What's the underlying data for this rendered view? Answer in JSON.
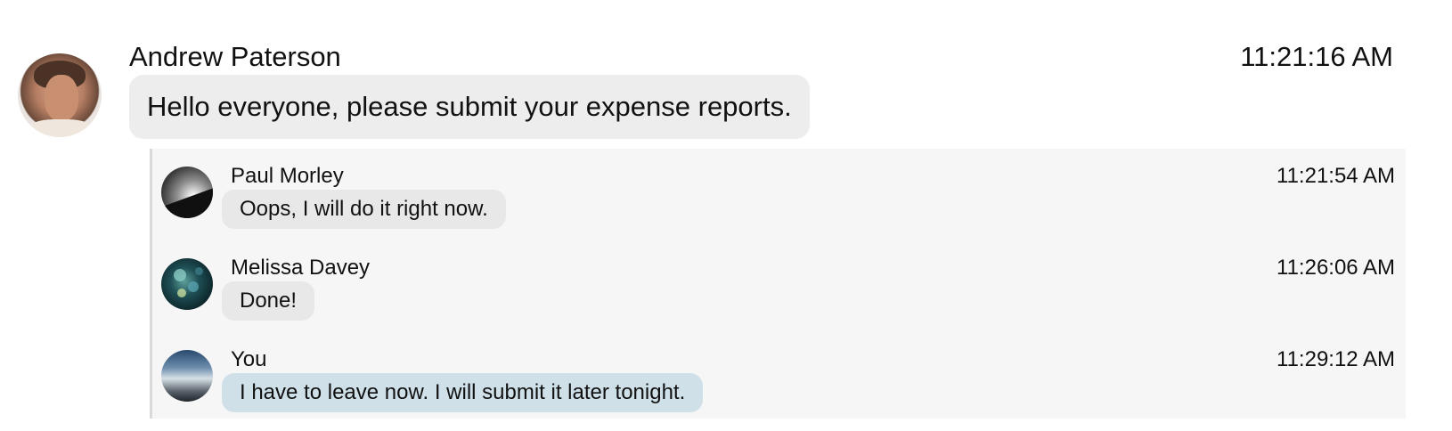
{
  "root_message": {
    "author": "Andrew Paterson",
    "time": "11:21:16 AM",
    "text": "Hello everyone, please submit your expense reports.",
    "avatar_icon": "user-photo-andrew"
  },
  "replies": [
    {
      "author": "Paul Morley",
      "time": "11:21:54 AM",
      "text": "Oops, I will do it right now.",
      "avatar_icon": "user-photo-paul",
      "is_self": false
    },
    {
      "author": "Melissa Davey",
      "time": "11:26:06 AM",
      "text": "Done!",
      "avatar_icon": "user-photo-melissa",
      "is_self": false
    },
    {
      "author": "You",
      "time": "11:29:12 AM",
      "text": "I have to leave now. I will submit it later tonight.",
      "avatar_icon": "user-photo-you",
      "is_self": true
    }
  ],
  "colors": {
    "bubble_default": "#ededed",
    "bubble_reply": "#e8e8e8",
    "bubble_self": "#cfe0e9",
    "thread_background": "#f6f6f6",
    "thread_border": "#d9d9d9"
  }
}
